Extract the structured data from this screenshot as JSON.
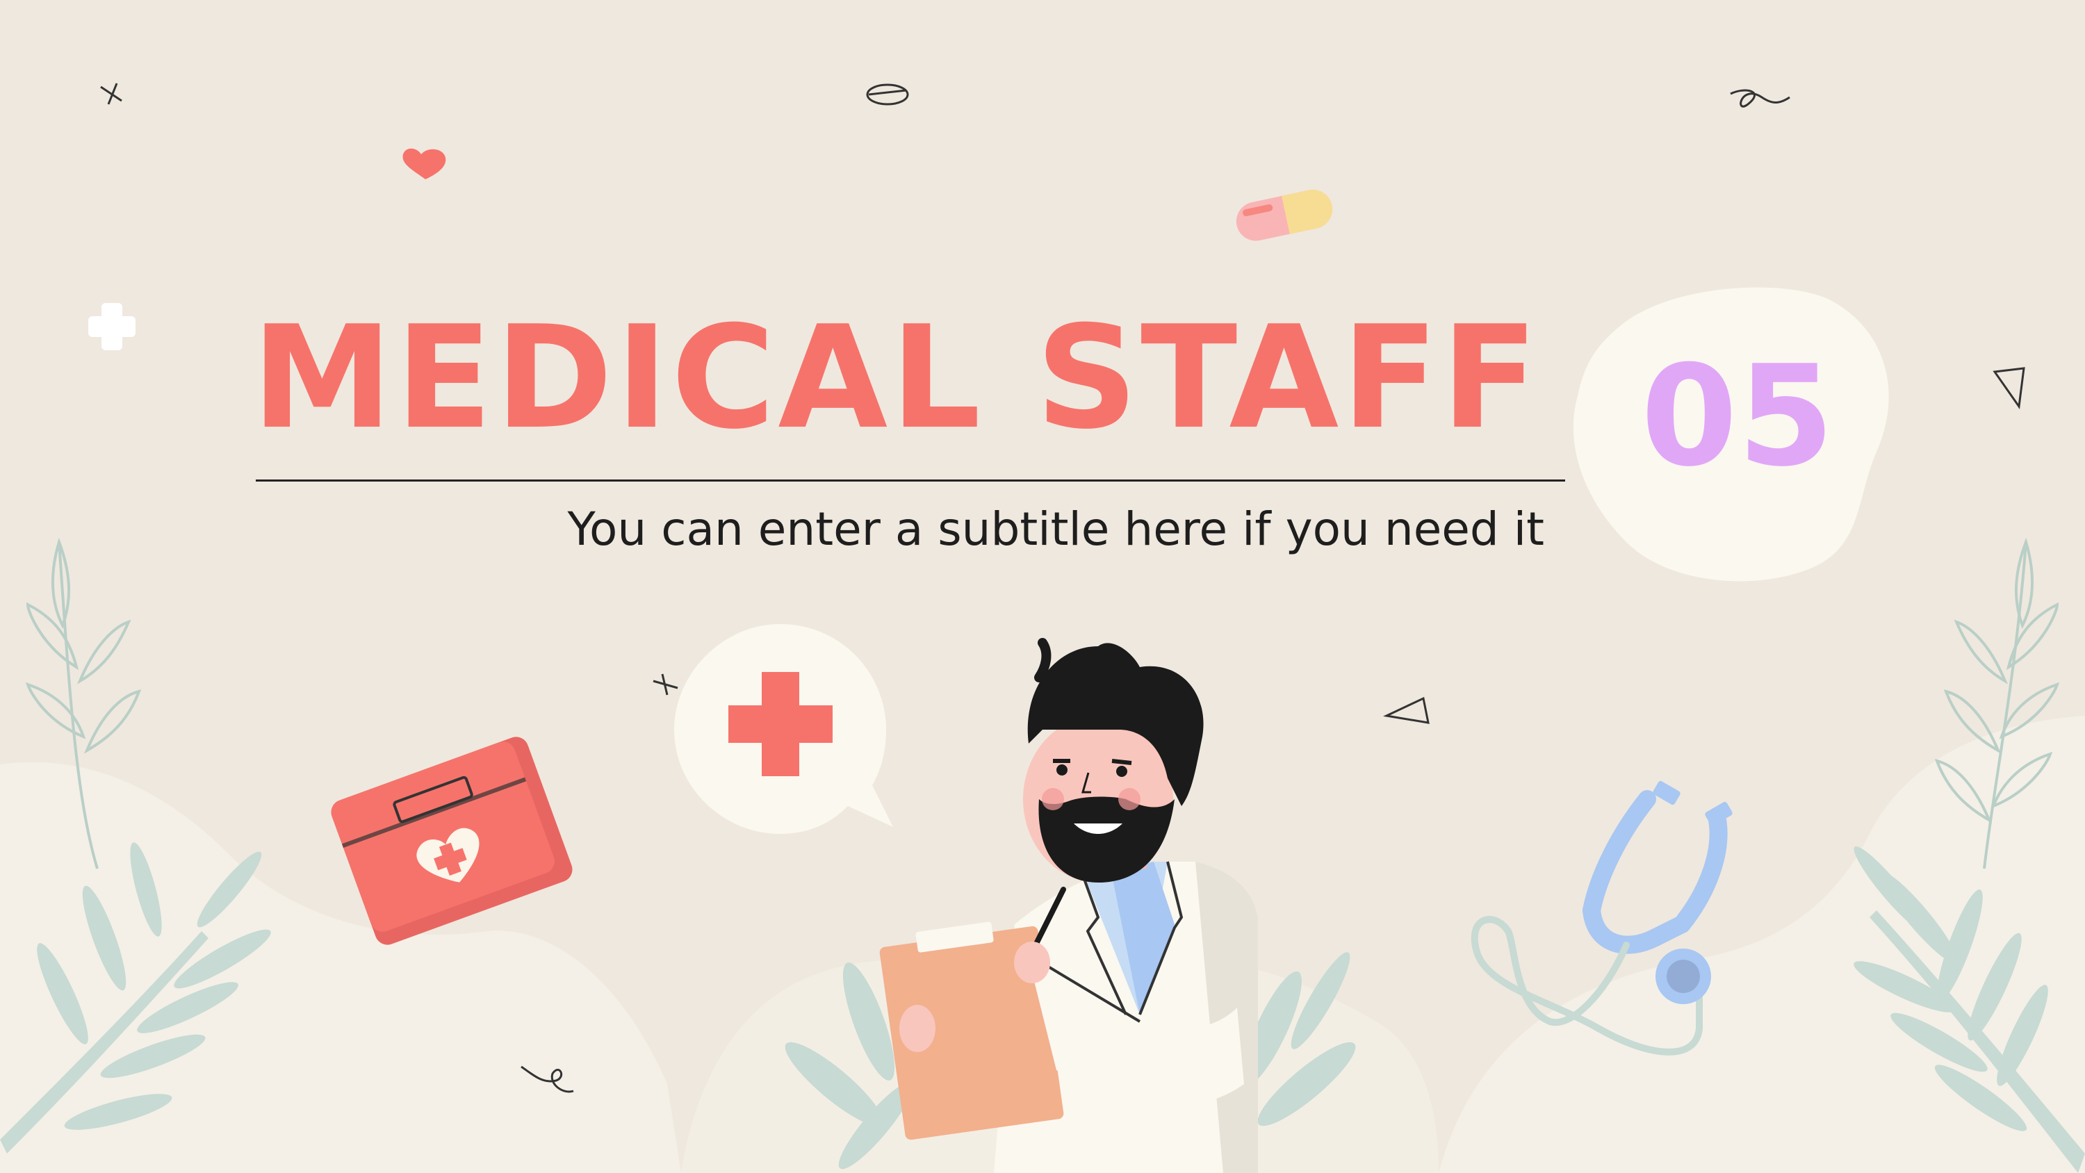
{
  "slide": {
    "title": "MEDICAL STAFF",
    "subtitle": "You can enter a subtitle here if you need it",
    "number": "05"
  },
  "icons": [
    "plus-sparkle-icon",
    "pill-icon",
    "heart-icon",
    "capsule-icon",
    "first-aid-kit-icon",
    "speech-bubble-cross-icon",
    "stethoscope-icon",
    "triangle-icon",
    "swirl-icon",
    "leaf-icon",
    "doctor-illustration"
  ],
  "colors": {
    "background": "#efe8de",
    "title": "#f6736b",
    "number": "#e1a7f7",
    "number_blob": "#fbf8f0",
    "leaf": "#c7dad3",
    "accent_red": "#f6736b"
  }
}
